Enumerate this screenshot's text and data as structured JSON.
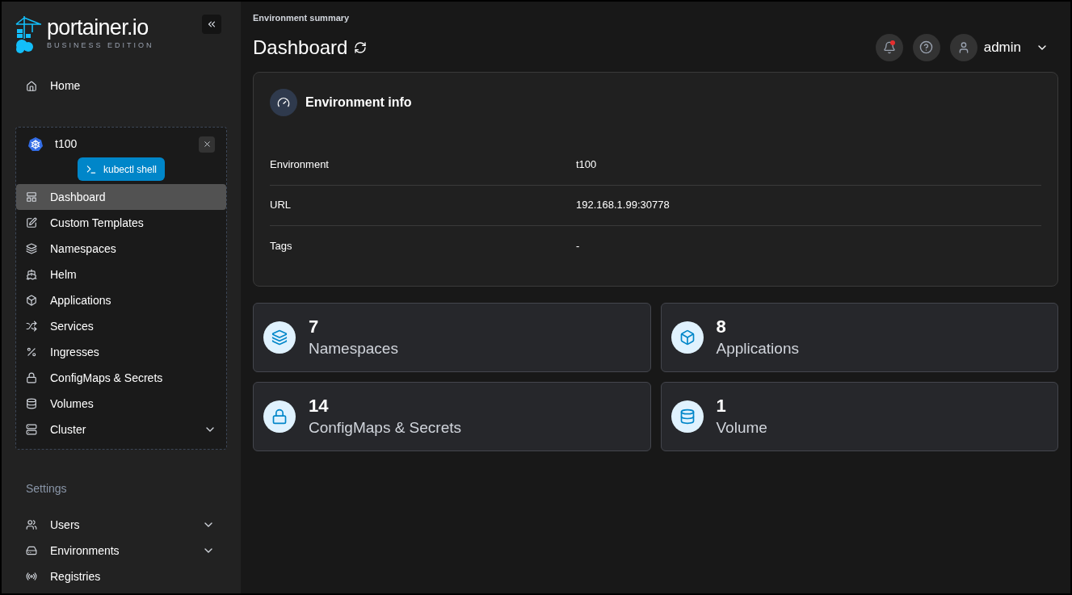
{
  "brand": {
    "name": "portainer.io",
    "edition": "BUSINESS EDITION"
  },
  "home": {
    "label": "Home"
  },
  "environment": {
    "name": "t100",
    "shell_button": "kubectl shell",
    "items": [
      {
        "label": "Dashboard",
        "selected": true,
        "kind": "link"
      },
      {
        "label": "Custom Templates",
        "selected": false,
        "kind": "link"
      },
      {
        "label": "Namespaces",
        "selected": false,
        "kind": "link"
      },
      {
        "label": "Helm",
        "selected": false,
        "kind": "link"
      },
      {
        "label": "Applications",
        "selected": false,
        "kind": "link"
      },
      {
        "label": "Services",
        "selected": false,
        "kind": "link"
      },
      {
        "label": "Ingresses",
        "selected": false,
        "kind": "link"
      },
      {
        "label": "ConfigMaps & Secrets",
        "selected": false,
        "kind": "link"
      },
      {
        "label": "Volumes",
        "selected": false,
        "kind": "link"
      },
      {
        "label": "Cluster",
        "selected": false,
        "kind": "group",
        "expanded": false
      }
    ]
  },
  "settings": {
    "heading": "Settings",
    "items": [
      {
        "label": "Users",
        "kind": "group",
        "expanded": false
      },
      {
        "label": "Environments",
        "kind": "group",
        "expanded": false
      },
      {
        "label": "Registries",
        "kind": "link"
      }
    ]
  },
  "header": {
    "breadcrumb": "Environment summary",
    "title": "Dashboard",
    "notification": true,
    "user": "admin"
  },
  "env_info": {
    "title": "Environment info",
    "rows": [
      {
        "label": "Environment",
        "value": "t100"
      },
      {
        "label": "URL",
        "value": "192.168.1.99:30778"
      },
      {
        "label": "Tags",
        "value": "-"
      }
    ]
  },
  "stats": [
    {
      "count": "7",
      "label": "Namespaces"
    },
    {
      "count": "8",
      "label": "Applications"
    },
    {
      "count": "14",
      "label": "ConfigMaps & Secrets"
    },
    {
      "count": "1",
      "label": "Volume"
    }
  ]
}
